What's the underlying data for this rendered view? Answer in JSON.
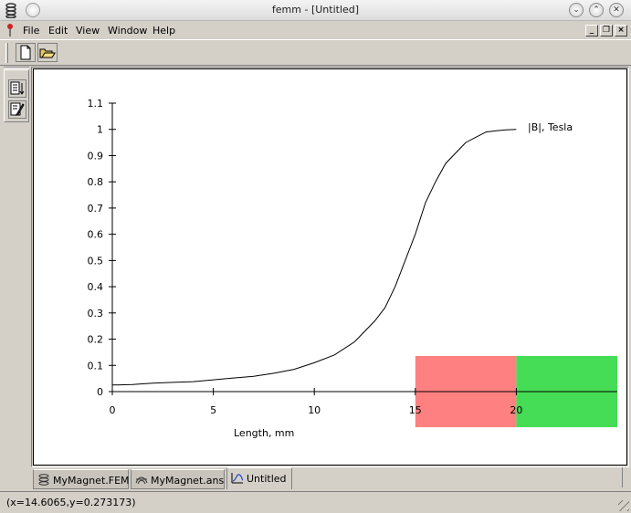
{
  "window": {
    "title": "femm - [Untitled]"
  },
  "menu": {
    "items": [
      "File",
      "Edit",
      "View",
      "Window",
      "Help"
    ]
  },
  "toolbar": {
    "buttons": [
      "new-document-icon",
      "open-folder-icon"
    ]
  },
  "sidebar": {
    "buttons": [
      "sort-list-icon",
      "edit-properties-icon"
    ]
  },
  "tabs": [
    {
      "label": "MyMagnet.FEM",
      "icon": "coil-icon"
    },
    {
      "label": "MyMagnet.ans",
      "icon": "field-solution-icon"
    },
    {
      "label": "Untitled",
      "icon": "plot-icon"
    }
  ],
  "status": {
    "coords": "(x=14.6065,y=0.273173)"
  },
  "chart_data": {
    "type": "line",
    "xlabel": "Length, mm",
    "ylabel": "",
    "xlim": [
      0,
      25
    ],
    "ylim": [
      0,
      1.1
    ],
    "x_ticks": [
      "0",
      "5",
      "10",
      "15",
      "20"
    ],
    "y_ticks": [
      "0",
      "0.1",
      "0.2",
      "0.3",
      "0.4",
      "0.5",
      "0.6",
      "0.7",
      "0.8",
      "0.9",
      "1",
      "1.1"
    ],
    "series": [
      {
        "name": "|B|, Tesla",
        "color": "#000000",
        "x": [
          0,
          1,
          2,
          3,
          4,
          5,
          6,
          7,
          8,
          9,
          10,
          11,
          12,
          12.5,
          13,
          13.5,
          14,
          14.5,
          15,
          15.5,
          16,
          16.5,
          17,
          17.5,
          18,
          18.5,
          19,
          19.5,
          20
        ],
        "y": [
          0.025,
          0.027,
          0.032,
          0.035,
          0.038,
          0.045,
          0.052,
          0.058,
          0.07,
          0.085,
          0.11,
          0.14,
          0.19,
          0.23,
          0.27,
          0.32,
          0.4,
          0.5,
          0.6,
          0.72,
          0.8,
          0.87,
          0.91,
          0.95,
          0.97,
          0.99,
          0.995,
          0.998,
          1.0
        ]
      }
    ],
    "legend_position": "top-right",
    "grid": false,
    "colormap_blocks": [
      {
        "x_start": 15,
        "x_end": 20,
        "color": "#ff8080"
      },
      {
        "x_start": 20,
        "x_end": 25,
        "color": "#44dd55"
      }
    ]
  }
}
